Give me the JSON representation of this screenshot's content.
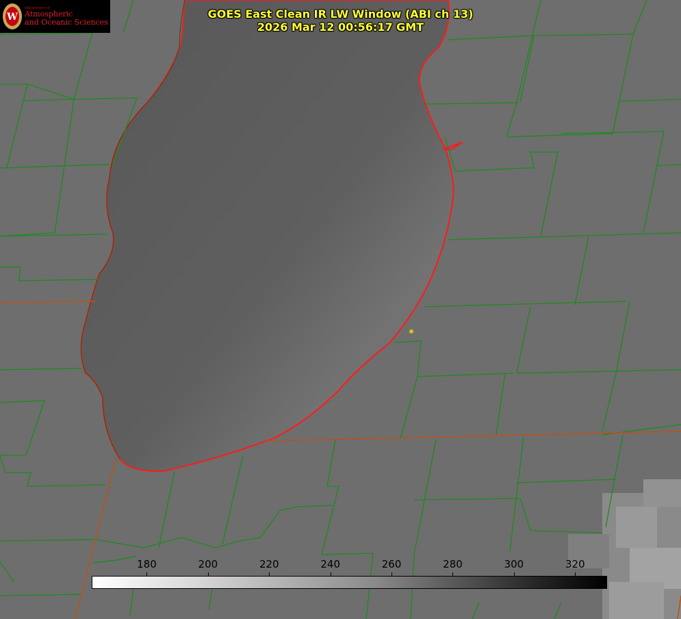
{
  "header": {
    "title_line1": "GOES East Clean IR LW Window (ABI ch 13)",
    "title_line2": "2026 Mar 12 00:56:17 GMT"
  },
  "logo": {
    "department": "Department of",
    "line1": "Atmospheric",
    "line2": "and Oceanic Sciences",
    "seal_letter": "W"
  },
  "colorbar": {
    "ticks": [
      "180",
      "200",
      "220",
      "240",
      "260",
      "280",
      "300",
      "320"
    ],
    "tick_values": [
      180,
      200,
      220,
      240,
      260,
      280,
      300,
      320
    ],
    "range": [
      162,
      330
    ]
  },
  "colors": {
    "title": "#ffff33",
    "county_lines": "#1e8a1e",
    "state_lines": "#b5551a",
    "lake_outline": "#ff1a1a",
    "marker": "#d4c21a"
  }
}
